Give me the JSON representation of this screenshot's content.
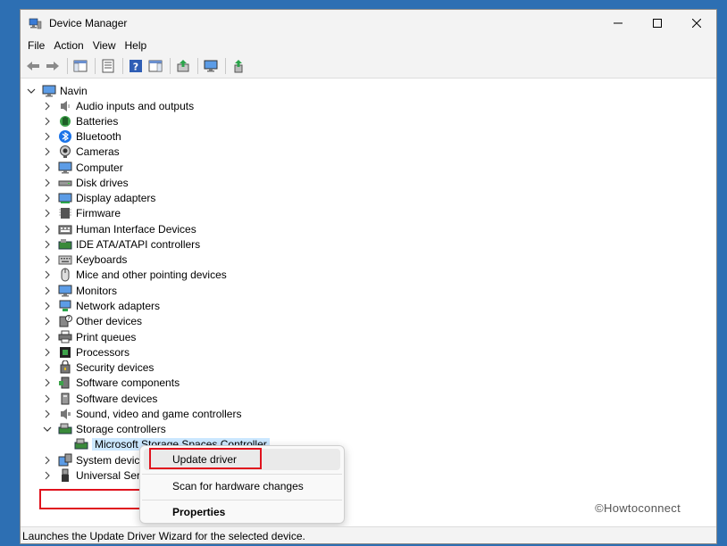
{
  "window": {
    "title": "Device Manager"
  },
  "menubar": {
    "items": [
      "File",
      "Action",
      "View",
      "Help"
    ]
  },
  "tree": {
    "root": "Navin",
    "categories": [
      {
        "label": "Audio inputs and outputs",
        "icon": "speaker-icon"
      },
      {
        "label": "Batteries",
        "icon": "battery-icon"
      },
      {
        "label": "Bluetooth",
        "icon": "bluetooth-icon"
      },
      {
        "label": "Cameras",
        "icon": "camera-icon"
      },
      {
        "label": "Computer",
        "icon": "computer-icon"
      },
      {
        "label": "Disk drives",
        "icon": "disk-drive-icon"
      },
      {
        "label": "Display adapters",
        "icon": "display-adapter-icon"
      },
      {
        "label": "Firmware",
        "icon": "firmware-icon"
      },
      {
        "label": "Human Interface Devices",
        "icon": "hid-icon"
      },
      {
        "label": "IDE ATA/ATAPI controllers",
        "icon": "ide-controller-icon"
      },
      {
        "label": "Keyboards",
        "icon": "keyboard-icon"
      },
      {
        "label": "Mice and other pointing devices",
        "icon": "mouse-icon"
      },
      {
        "label": "Monitors",
        "icon": "monitor-icon"
      },
      {
        "label": "Network adapters",
        "icon": "network-adapter-icon"
      },
      {
        "label": "Other devices",
        "icon": "other-devices-icon"
      },
      {
        "label": "Print queues",
        "icon": "printer-icon"
      },
      {
        "label": "Processors",
        "icon": "processor-icon"
      },
      {
        "label": "Security devices",
        "icon": "security-device-icon"
      },
      {
        "label": "Software components",
        "icon": "software-component-icon"
      },
      {
        "label": "Software devices",
        "icon": "software-device-icon"
      },
      {
        "label": "Sound, video and game controllers",
        "icon": "sound-controller-icon"
      },
      {
        "label": "Storage controllers",
        "icon": "storage-controller-icon"
      },
      {
        "label": "Microsoft Storage Spaces Controller",
        "icon": "storage-controller-icon"
      },
      {
        "label": "System devices",
        "icon": "system-device-icon"
      },
      {
        "label": "Universal Serial Bus controllers",
        "icon": "usb-icon"
      }
    ]
  },
  "context_menu": {
    "update_driver": "Update driver",
    "scan": "Scan for hardware changes",
    "properties": "Properties"
  },
  "watermark": "©Howtoconnect",
  "status": {
    "text": "Launches the Update Driver Wizard for the selected device."
  },
  "colors": {
    "highlight_box": "#e0121d",
    "selection": "#cce8ff",
    "desktop": "#2d6fb3"
  }
}
